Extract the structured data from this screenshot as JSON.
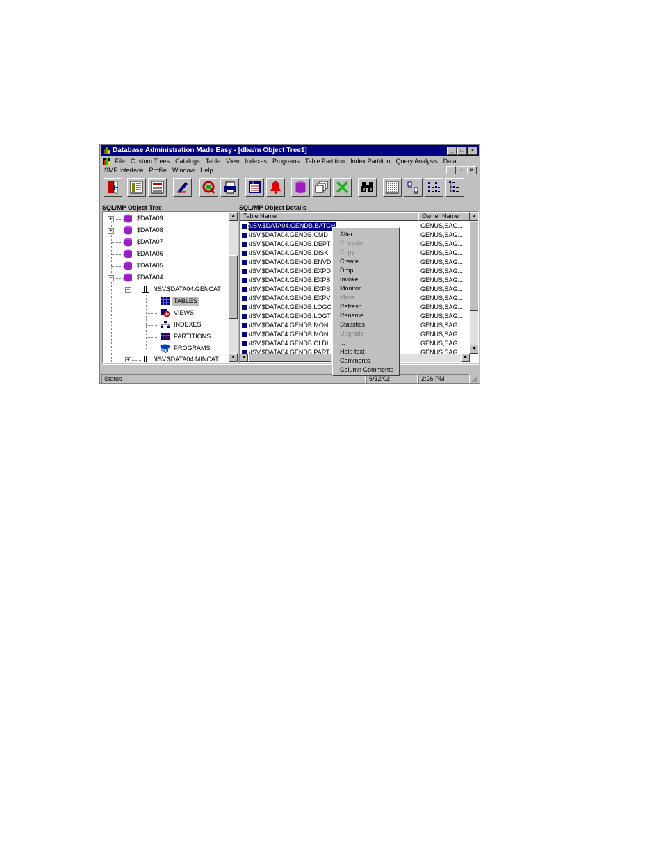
{
  "window": {
    "title": "Database Administration Made Easy - [dba/m Object Tree1]",
    "controls": [
      "_",
      "□",
      "×"
    ]
  },
  "menu": {
    "row1": [
      "File",
      "Custom Trees",
      "Catalogs",
      "Table",
      "View",
      "Indexes",
      "Programs",
      "Table Partition",
      "Index Partition",
      "Query Analysis",
      "Data"
    ],
    "row2": [
      "SMF Interface",
      "Profile",
      "Window",
      "Help"
    ],
    "mdi_controls": [
      "_",
      "▫",
      "×"
    ]
  },
  "toolbar": {
    "buttons": [
      "exit-icon",
      "catalog-icon",
      "form-icon",
      "select-icon",
      "query-icon",
      "print-icon",
      "monitor-icon",
      "alarm-bell-icon",
      "database-icon",
      "windows-icon",
      "close-x-icon",
      "binoculars-icon",
      "details-view-icon",
      "small-icons-icon",
      "list-view-icon",
      "tree-view-icon"
    ],
    "select_text": "select"
  },
  "tree": {
    "label": "SQL/MP Object Tree",
    "items": [
      {
        "text": "$DATA09",
        "expander": "+"
      },
      {
        "text": "$DATA08",
        "expander": "+"
      },
      {
        "text": "$DATA07",
        "expander": ""
      },
      {
        "text": "$DATA06",
        "expander": ""
      },
      {
        "text": "$DATA05",
        "expander": ""
      },
      {
        "text": "$DATA04",
        "expander": "−"
      },
      {
        "text": "\\ISV.$DATA04.GENCAT",
        "expander": "−"
      },
      {
        "text": "TABLES"
      },
      {
        "text": "VIEWS"
      },
      {
        "text": "INDEXES"
      },
      {
        "text": "PARTITIONS"
      },
      {
        "text": "PROGRAMS"
      },
      {
        "text": "\\ISV.$DATA04.MINCAT",
        "expander": "+"
      }
    ]
  },
  "details": {
    "label": "SQL/MP Object Details",
    "columns": [
      "Table Name",
      "Owner Name"
    ],
    "rows": [
      {
        "name": "\\ISV.$DATA04.GENDB.BATCH",
        "owner": "GENUS,SAG..."
      },
      {
        "name": "\\ISV.$DATA04.GENDB.CMD",
        "owner": "GENUS,SAG..."
      },
      {
        "name": "\\ISV.$DATA04.GENDB.DEPT",
        "owner": "GENUS,SAG..."
      },
      {
        "name": "\\ISV.$DATA04.GENDB.DISK",
        "owner": "GENUS,SAG..."
      },
      {
        "name": "\\ISV.$DATA04.GENDB.ENVD",
        "owner": "GENUS,SAG..."
      },
      {
        "name": "\\ISV.$DATA04.GENDB.EXPD",
        "owner": "GENUS,SAG..."
      },
      {
        "name": "\\ISV.$DATA04.GENDB.EXPS",
        "owner": "GENUS,SAG..."
      },
      {
        "name": "\\ISV.$DATA04.GENDB.EXPS",
        "owner": "GENUS,SAG..."
      },
      {
        "name": "\\ISV.$DATA04.GENDB.EXPV",
        "owner": "GENUS,SAG..."
      },
      {
        "name": "\\ISV.$DATA04.GENDB.LOGC",
        "owner": "GENUS,SAG..."
      },
      {
        "name": "\\ISV.$DATA04.GENDB.LOGT",
        "owner": "GENUS,SAG..."
      },
      {
        "name": "\\ISV.$DATA04.GENDB.MON",
        "owner": "GENUS,SAG..."
      },
      {
        "name": "\\ISV.$DATA04.GENDB.MON",
        "owner": "GENUS,SAG..."
      },
      {
        "name": "\\ISV.$DATA04.GENDB.OLDI",
        "owner": "GENUS,SAG..."
      },
      {
        "name": "\\ISV.$DATA04.GENDB.PART",
        "owner": "GENUS,SAG..."
      }
    ]
  },
  "context_menu": {
    "items": [
      {
        "label": "Alter",
        "enabled": true
      },
      {
        "label": "Compile",
        "enabled": false
      },
      {
        "label": "Copy",
        "enabled": false
      },
      {
        "label": "Create",
        "enabled": true
      },
      {
        "label": "Drop",
        "enabled": true
      },
      {
        "label": "Invoke",
        "enabled": true
      },
      {
        "label": "Monitor",
        "enabled": true
      },
      {
        "label": "Move",
        "enabled": false
      },
      {
        "label": "Refresh",
        "enabled": true
      },
      {
        "label": "Rename",
        "enabled": true
      },
      {
        "label": "Statistics",
        "enabled": true
      },
      {
        "label": "Upgrade",
        "enabled": false
      },
      {
        "label": "...",
        "enabled": true
      },
      {
        "label": "Help text",
        "enabled": true
      },
      {
        "label": "Comments",
        "enabled": true
      },
      {
        "label": "Column Comments",
        "enabled": true
      }
    ]
  },
  "status": {
    "text": "Status",
    "date": "6/12/02",
    "time": "2:26 PM"
  },
  "colors": {
    "titlebar": "#000080",
    "selection": "#000080",
    "db_purple": "#9b1fbf"
  }
}
